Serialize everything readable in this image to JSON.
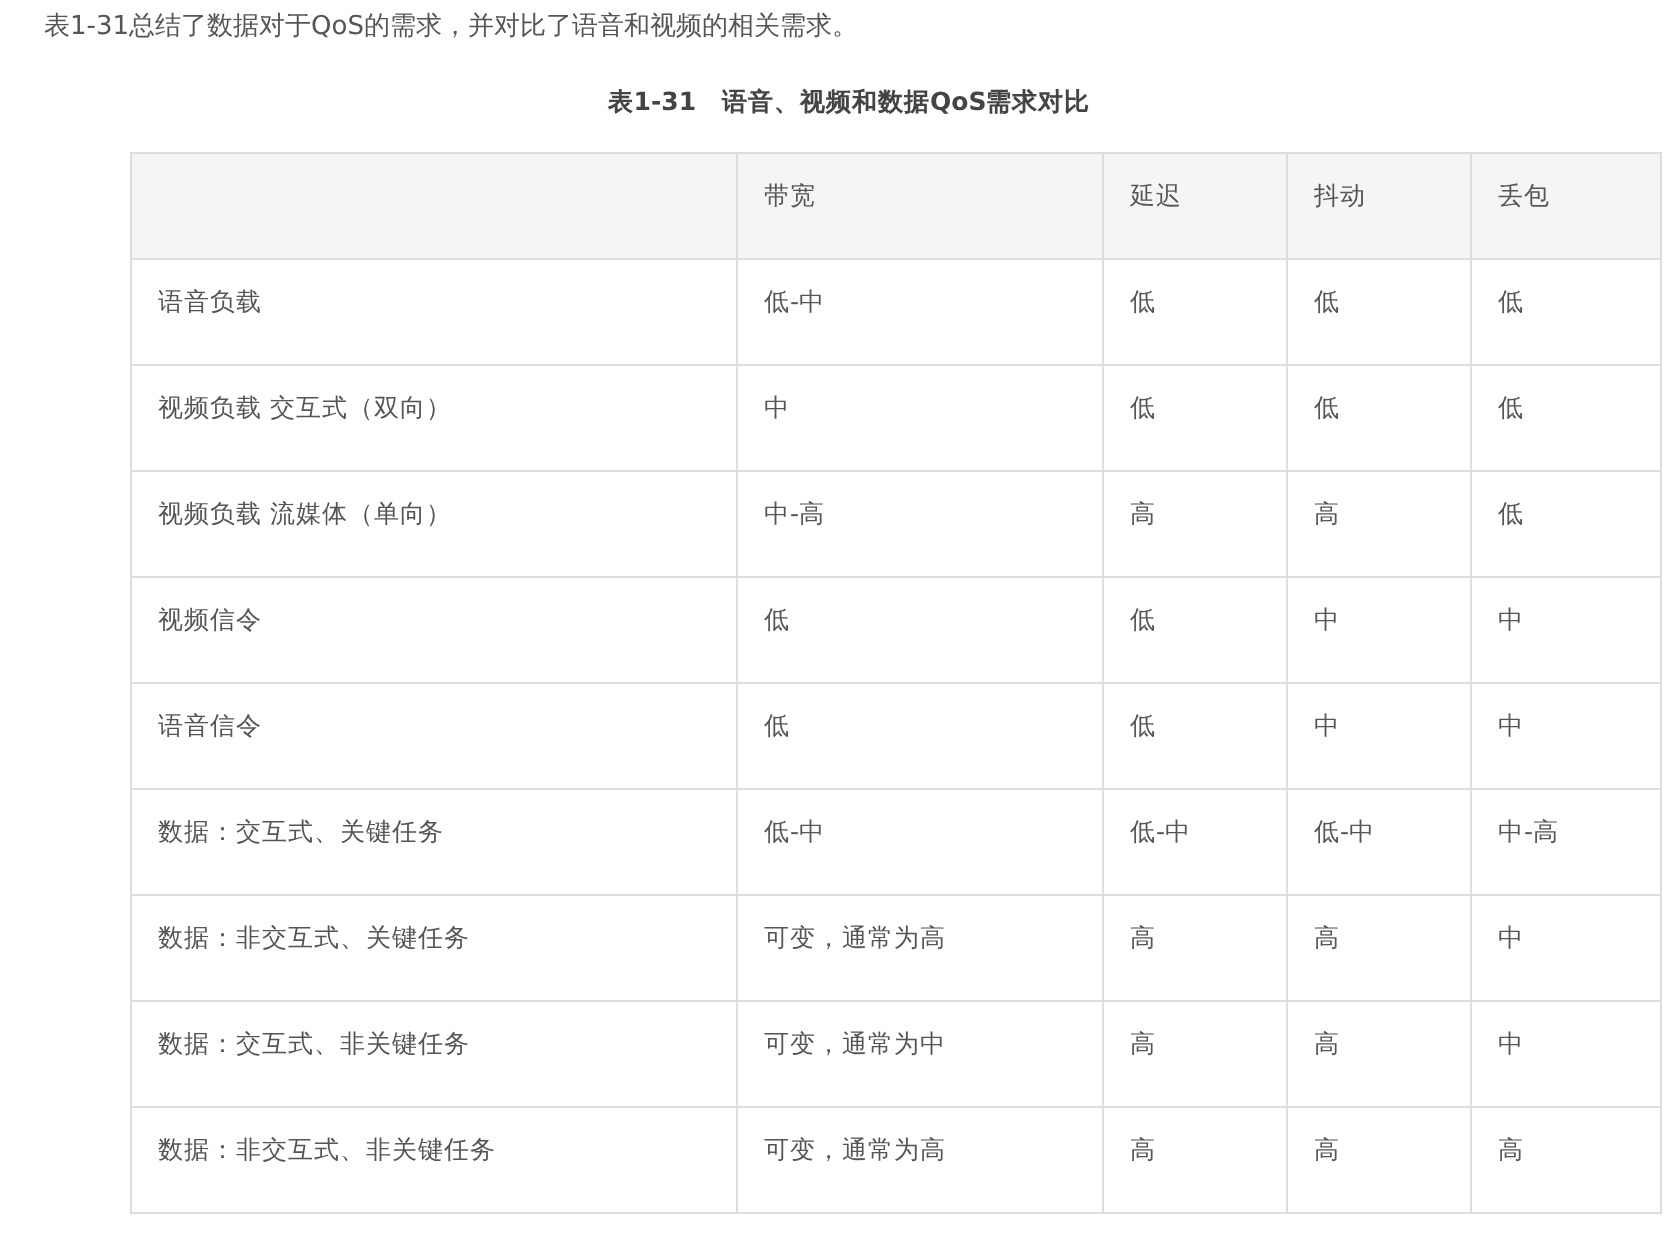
{
  "intro": "表1-31总结了数据对于QoS的需求，并对比了语音和视频的相关需求。",
  "table": {
    "caption": "表1-31　语音、视频和数据QoS需求对比",
    "columns": [
      "带宽",
      "延迟",
      "抖动",
      "丢包"
    ],
    "rows": [
      {
        "label": "语音负载",
        "cells": [
          "低-中",
          "低",
          "低",
          "低"
        ]
      },
      {
        "label": "视频负载 交互式（双向）",
        "cells": [
          "中",
          "低",
          "低",
          "低"
        ]
      },
      {
        "label": "视频负载 流媒体（单向）",
        "cells": [
          "中-高",
          "高",
          "高",
          "低"
        ]
      },
      {
        "label": "视频信令",
        "cells": [
          "低",
          "低",
          "中",
          "中"
        ]
      },
      {
        "label": "语音信令",
        "cells": [
          "低",
          "低",
          "中",
          "中"
        ]
      },
      {
        "label": "数据：交互式、关键任务",
        "cells": [
          "低-中",
          "低-中",
          "低-中",
          "中-高"
        ]
      },
      {
        "label": "数据：非交互式、关键任务",
        "cells": [
          "可变，通常为高",
          "高",
          "高",
          "中"
        ]
      },
      {
        "label": "数据：交互式、非关键任务",
        "cells": [
          "可变，通常为中",
          "高",
          "高",
          "中"
        ]
      },
      {
        "label": "数据：非交互式、非关键任务",
        "cells": [
          "可变，通常为高",
          "高",
          "高",
          "高"
        ]
      }
    ]
  }
}
